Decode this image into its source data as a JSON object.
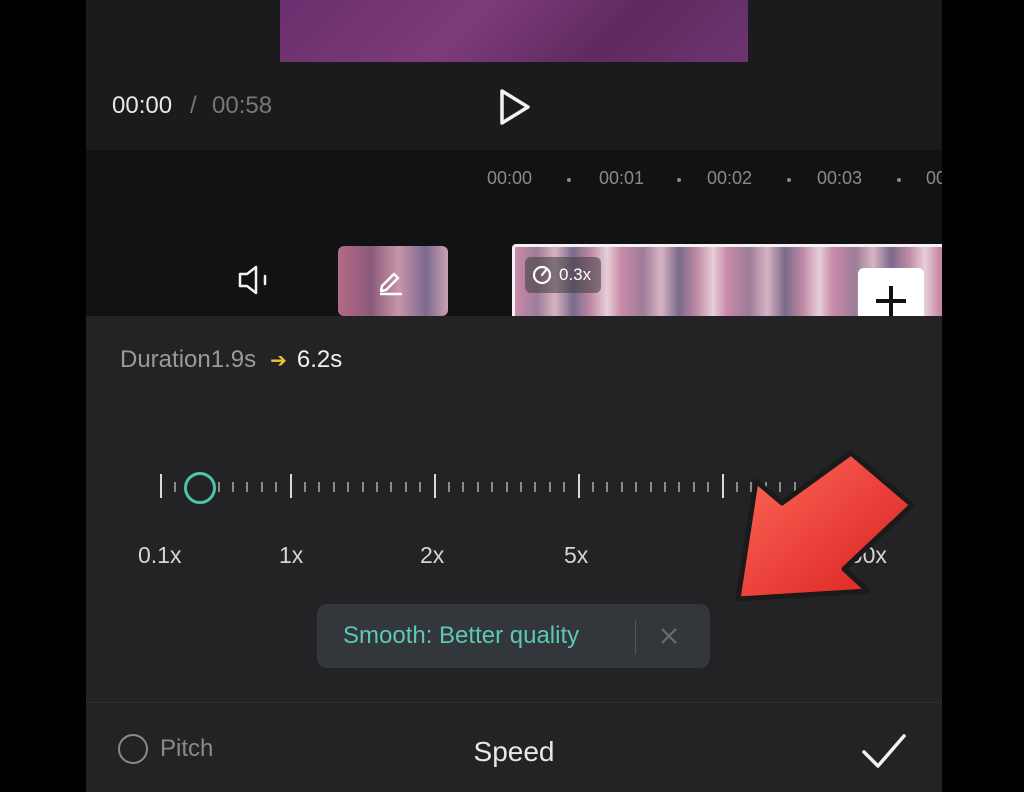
{
  "player": {
    "time_current": "00:00",
    "time_separator": "/",
    "time_total": "00:58"
  },
  "timeline": {
    "ruler": [
      "00:00",
      "00:01",
      "00:02",
      "00:03",
      "00"
    ],
    "clip_speed_badge": "0.3x"
  },
  "speed_panel": {
    "duration_label": "Duration",
    "duration_old": "1.9s",
    "duration_new": "6.2s",
    "slider_value": "0.3x",
    "scale_labels": [
      "0.1x",
      "1x",
      "2x",
      "5x",
      "100x"
    ],
    "tip_text": "Smooth: Better quality",
    "pitch_label": "Pitch",
    "pitch_checked": false,
    "title": "Speed"
  },
  "colors": {
    "accent_teal": "#4fc3b0",
    "arrow_yellow": "#f2c12e",
    "annotation_red": "#e8302c"
  },
  "icons": [
    "play-icon",
    "speaker-icon",
    "edit-icon",
    "speed-gauge-icon",
    "plus-icon",
    "close-icon",
    "checkmark-icon",
    "red-arrow-annotation"
  ]
}
